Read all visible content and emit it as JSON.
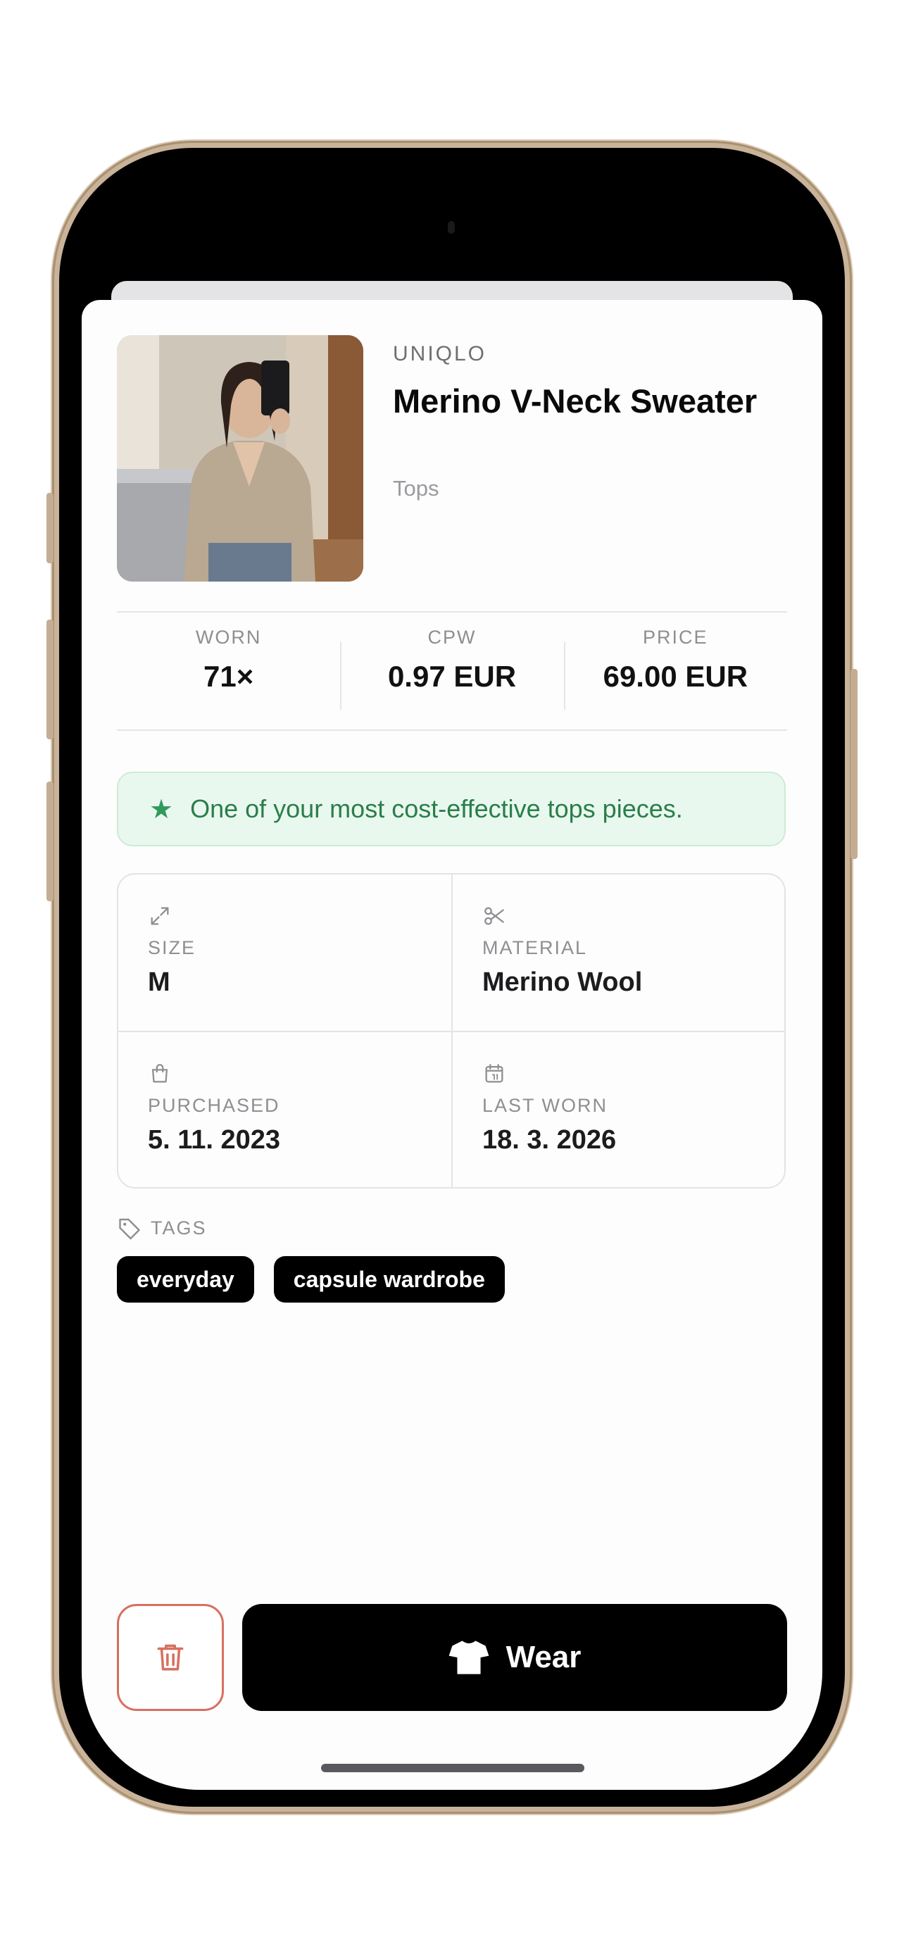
{
  "item": {
    "brand": "UNIQLO",
    "name": "Merino V-Neck Sweater",
    "category": "Tops"
  },
  "stats": [
    {
      "label": "WORN",
      "value": "71×"
    },
    {
      "label": "CPW",
      "value": "0.97 EUR"
    },
    {
      "label": "PRICE",
      "value": "69.00 EUR"
    }
  ],
  "banner": {
    "icon": "star-icon",
    "text": "One of your most cost-effective tops pieces.",
    "color": "#2a7e4a"
  },
  "details": [
    {
      "icon": "resize-arrows-icon",
      "label": "SIZE",
      "value": "M"
    },
    {
      "icon": "scissors-icon",
      "label": "MATERIAL",
      "value": "Merino Wool"
    },
    {
      "icon": "shopping-bag-icon",
      "label": "PURCHASED",
      "value": "5. 11. 2023"
    },
    {
      "icon": "calendar-icon",
      "label": "LAST WORN",
      "value": "18. 3. 2026"
    }
  ],
  "tags": {
    "heading": "TAGS",
    "items": [
      "everyday",
      "capsule wardrobe"
    ]
  },
  "actions": {
    "delete_icon": "trash-icon",
    "delete_color": "#d7705f",
    "wear_icon": "tshirt-icon",
    "wear_label": "Wear"
  }
}
